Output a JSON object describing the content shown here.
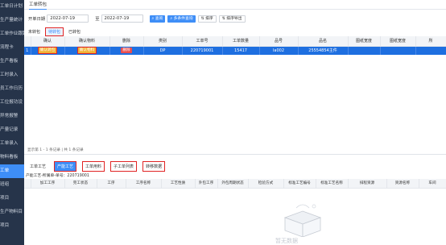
{
  "sidebar": {
    "items": [
      {
        "label": "工单日计划",
        "active": false
      },
      {
        "label": "生产量统计",
        "active": false
      },
      {
        "label": "工单作业跟踪",
        "active": false
      },
      {
        "label": "流程卡",
        "active": false
      },
      {
        "label": "生产看板",
        "active": false
      },
      {
        "label": "工时录入",
        "active": false
      },
      {
        "label": "员工作日历",
        "active": false
      },
      {
        "label": "工位报功设",
        "active": false
      },
      {
        "label": "异常报警",
        "active": false
      },
      {
        "label": "产量记录",
        "active": false
      },
      {
        "label": "工单录入",
        "active": false
      },
      {
        "label": "物料看板",
        "active": false
      },
      {
        "label": "工单",
        "active": true
      },
      {
        "label": "班组",
        "active": false
      },
      {
        "label": "项目",
        "active": false
      },
      {
        "label": "生产物料目",
        "active": false
      },
      {
        "label": "项目",
        "active": false
      }
    ]
  },
  "tab": {
    "label": "工单转包"
  },
  "filter": {
    "start_label": "开单日期",
    "start_value": "2022-07-19",
    "to_label": "至",
    "end_value": "2022-07-19",
    "buttons": [
      "查询",
      "多条件查询",
      "排序",
      "排序导出"
    ]
  },
  "subtabs": [
    "未转包",
    "待转包",
    "已转包"
  ],
  "grid": {
    "headers": [
      "",
      "确认",
      "确认物料",
      "删除",
      "类别",
      "工单号",
      "工单数量",
      "品号",
      "品名",
      "图纸宽度",
      "图纸宽度",
      "所"
    ],
    "rows": [
      {
        "idx": "1",
        "confirm": "确认转包",
        "material": "确认物料",
        "delete": "删除",
        "category": "DP",
        "order_no": "220719001",
        "qty": "15417",
        "item_no": "la002",
        "name": "25554854主件",
        "w1": "",
        "w2": "",
        "last": ""
      }
    ]
  },
  "pager": "显示第 1 - 1 条记录 | 共 1 条记录",
  "bottom_tabs": [
    "工单工艺",
    "产能工艺",
    "工单用料",
    "子工单列表",
    "转移数据"
  ],
  "crumb": "产能工艺-所属单-单号：220719001",
  "bottom_grid": {
    "headers": [
      "",
      "加工工序",
      "完工状态",
      "工序",
      "工序名称",
      "工艺性质",
      "外包工序",
      "外包周期状态",
      "检验方式",
      "标准工艺编号",
      "标准工艺名称",
      "排程资源",
      "资源名称",
      "车间"
    ]
  },
  "empty_text": "暂无数据"
}
